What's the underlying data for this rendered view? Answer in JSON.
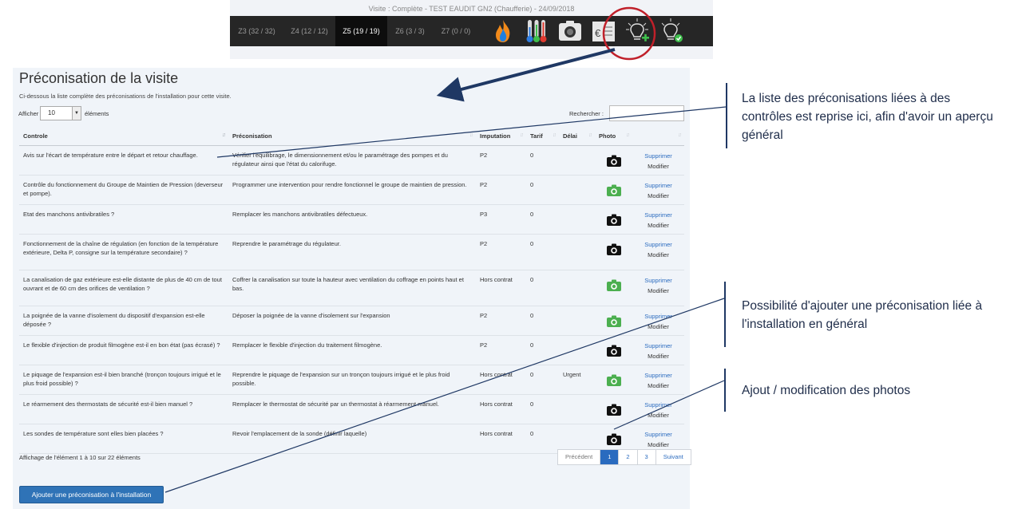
{
  "topbar": {
    "visit_info": "Visite : Complète - TEST EAUDIT GN2 (Chaufferie) - 24/09/2018",
    "zones": [
      {
        "label": "Z3 (32 / 32)",
        "active": false
      },
      {
        "label": "Z4 (12 / 12)",
        "active": false
      },
      {
        "label": "Z5 (19 / 19)",
        "active": true
      },
      {
        "label": "Z6 (3 / 3)",
        "active": false
      },
      {
        "label": "Z7 (0 / 0)",
        "active": false
      }
    ],
    "tools": [
      "flame-icon",
      "thermometers-icon",
      "camera-icon",
      "cost-icon",
      "add-recommendation-icon",
      "validated-recommendation-icon"
    ]
  },
  "page": {
    "title": "Préconisation de la visite",
    "subtitle": "Ci-dessous la liste complète des préconisations de l'installation pour cette visite.",
    "length_prefix": "Afficher",
    "length_value": "10",
    "length_suffix": "éléments",
    "search_label": "Rechercher :",
    "search_value": ""
  },
  "table": {
    "headers": [
      "Controle",
      "Préconisation",
      "Imputation",
      "Tarif",
      "Délai",
      "Photo",
      ""
    ],
    "delete_label": "Supprimer",
    "modify_label": "Modifier",
    "rows": [
      {
        "controle": "Avis sur l'écart de température entre le départ et retour chauffage.",
        "preconisation": "Vérifier l'équilibrage, le dimensionnement et/ou le paramétrage des pompes et du régulateur ainsi que l'état du calorifuge.",
        "imputation": "P2",
        "tarif": "0",
        "delai": "",
        "photo": "black"
      },
      {
        "controle": "Contrôle du fonctionnement du Groupe de Maintien de Pression (deverseur et pompe).",
        "preconisation": "Programmer une intervention pour rendre fonctionnel le groupe de maintien de pression.",
        "imputation": "P2",
        "tarif": "0",
        "delai": "",
        "photo": "green"
      },
      {
        "controle": "Etat des manchons antivibratiles ?",
        "preconisation": "Remplacer les manchons antivibratiles défectueux.",
        "imputation": "P3",
        "tarif": "0",
        "delai": "",
        "photo": "black"
      },
      {
        "controle": "Fonctionnement de la chaîne de régulation (en fonction de la température extérieure, Delta P, consigne sur la température secondaire) ?",
        "preconisation": "Reprendre le paramétrage du régulateur.",
        "imputation": "P2",
        "tarif": "0",
        "delai": "",
        "photo": "black"
      },
      {
        "controle": "La canalisation de gaz extérieure est-elle distante de plus de 40 cm de tout ouvrant et de 60 cm des orifices de ventilation ?",
        "preconisation": "Coffrer la canalisation sur toute la hauteur avec ventilation du coffrage en points haut et bas.",
        "imputation": "Hors contrat",
        "tarif": "0",
        "delai": "",
        "photo": "green"
      },
      {
        "controle": "La poignée de la vanne d'isolement du dispositif d'expansion est-elle déposée ?",
        "preconisation": "Déposer la poignée de la vanne d'isolement sur l'expansion",
        "imputation": "P2",
        "tarif": "0",
        "delai": "",
        "photo": "green"
      },
      {
        "controle": "Le flexible d'injection de produit filmogène est-il en bon état (pas écrasé) ?",
        "preconisation": "Remplacer le flexible d'injection du traitement filmogène.",
        "imputation": "P2",
        "tarif": "0",
        "delai": "",
        "photo": "black"
      },
      {
        "controle": "Le piquage de l'expansion est-il bien branché (tronçon toujours irrigué et le plus froid possible) ?",
        "preconisation": "Reprendre le piquage de l'expansion sur un tronçon toujours irrigué et le plus froid possible.",
        "imputation": "Hors contrat",
        "tarif": "0",
        "delai": "Urgent",
        "photo": "green"
      },
      {
        "controle": "Le réarmement des thermostats de sécurité est-il bien manuel ?",
        "preconisation": "Remplacer le thermostat de sécurité par un thermostat à réarmement manuel.",
        "imputation": "Hors contrat",
        "tarif": "0",
        "delai": "",
        "photo": "black"
      },
      {
        "controle": "Les sondes de température sont elles bien placées ?",
        "preconisation": "Revoir l'emplacement de la sonde (définir laquelle)",
        "imputation": "Hors contrat",
        "tarif": "0",
        "delai": "",
        "photo": "black"
      }
    ]
  },
  "footer": {
    "info": "Affichage de l'élément 1 à 10 sur 22 éléments",
    "pagination": [
      "Précédent",
      "1",
      "2",
      "3",
      "Suivant"
    ],
    "active_page": "1",
    "add_button": "Ajouter une préconisation à l'installation"
  },
  "annotations": [
    {
      "text": "La liste des préconisations liées à des contrôles est reprise ici, afin d'avoir un aperçu général"
    },
    {
      "text": "Possibilité d'ajouter une préconisation liée à l'installation en général"
    },
    {
      "text": "Ajout / modification des photos"
    }
  ],
  "colors": {
    "primary": "#2f73b7",
    "annotation": "#1f3864",
    "highlight_circle": "#c0202a",
    "photo_green": "#4caf50",
    "zone_bar": "#262626"
  }
}
